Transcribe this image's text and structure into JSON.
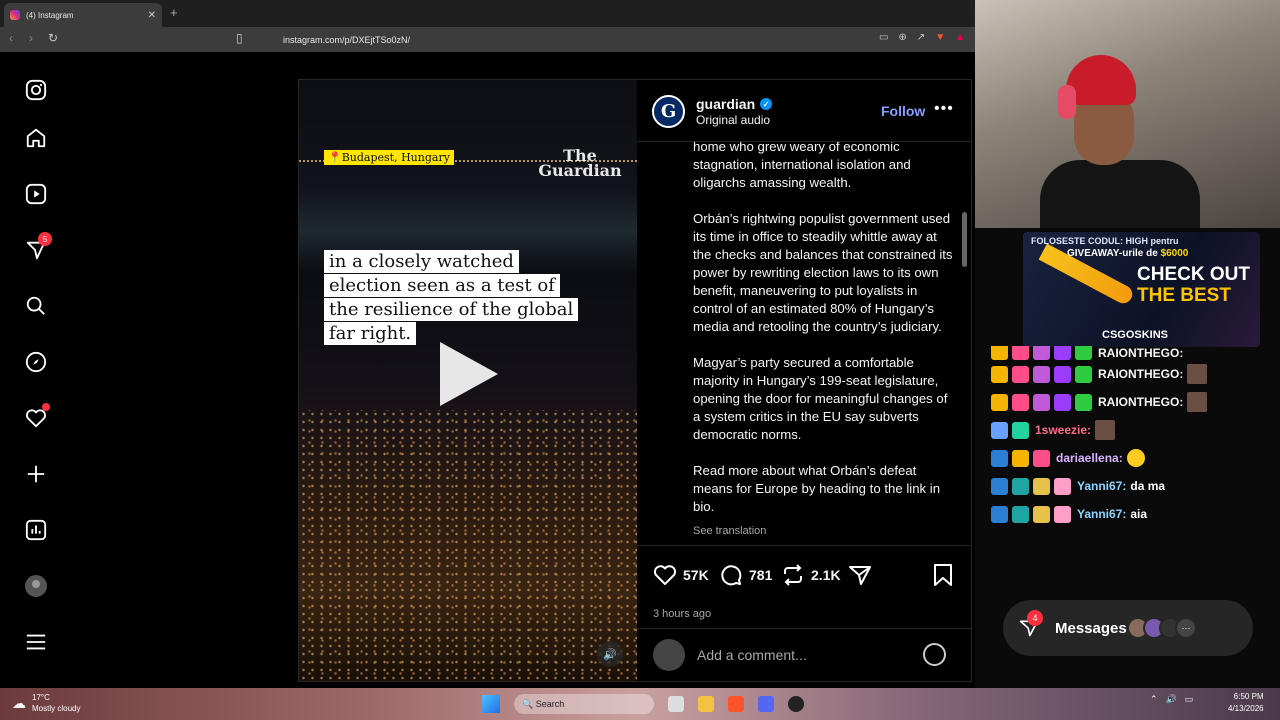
{
  "browser": {
    "tab_title": "(4) Instagram",
    "tab_close": "✕",
    "new_tab": "+",
    "url": "instagram.com/p/DXEjtTSo0zN/"
  },
  "sidebar": {
    "notifications_badge": "5"
  },
  "post": {
    "location_tag": "Budapest, Hungary",
    "brand_watermark": "The Guardian",
    "video_caption": "in a closely watched election seen as a test of the resilience of the global far right.",
    "username": "guardian",
    "audio": "Original audio",
    "follow_label": "Follow",
    "more_label": "•••",
    "body_paragraphs": [
      "home who grew weary of economic stagnation, international isolation and oligarchs amassing wealth.",
      "Orbán’s rightwing populist government used its time in office to steadily whittle away at the checks and balances that constrained its power by rewriting election laws to its own benefit, maneuvering to put loyalists in control of an estimated 80% of Hungary’s media and retooling the country’s judiciary.",
      "Magyar’s party secured a comfortable majority in Hungary’s 199-seat legislature, opening the door for meaningful changes of a system critics in the EU say subverts democratic norms.",
      "Read more about what Orbán’s defeat means for Europe by heading to the link in bio."
    ],
    "see_translation": "See translation",
    "likes": "57K",
    "comments": "781",
    "reposts": "2.1K",
    "time_ago": "3 hours ago",
    "comment_placeholder": "Add a comment..."
  },
  "messages_bar": {
    "label": "Messages",
    "badge": "4",
    "more": "···"
  },
  "stream_ad": {
    "line1": "FOLOSESTE CODUL: HIGH pentru",
    "line2_prefix": "GIVEAWAY-urile de ",
    "line2_amount": "$6000",
    "check_out": "CHECK OUT",
    "the_best": "THE BEST",
    "brand": "CSGOSKINS"
  },
  "chat": [
    {
      "user": "RAIONTHEGO:",
      "msg": "",
      "color": "#ffffff",
      "partial": true
    },
    {
      "user": "RAIONTHEGO:",
      "msg": "",
      "color": "#ffffff"
    },
    {
      "user": "RAIONTHEGO:",
      "msg": "",
      "color": "#ffffff"
    },
    {
      "user": "1sweezie:",
      "msg": "",
      "color": "#ff6b8a"
    },
    {
      "user": "dariaellena:",
      "msg": "",
      "color": "#d7b3ff"
    },
    {
      "user": "Yanni67:",
      "msg": "da ma",
      "color": "#8fd3ff"
    },
    {
      "user": "Yanni67:",
      "msg": "aia",
      "color": "#8fd3ff"
    }
  ],
  "taskbar": {
    "temperature": "17°C",
    "weather": "Mostly cloudy",
    "search": "Search",
    "time": "6:50 PM",
    "date": "4/13/2026"
  }
}
